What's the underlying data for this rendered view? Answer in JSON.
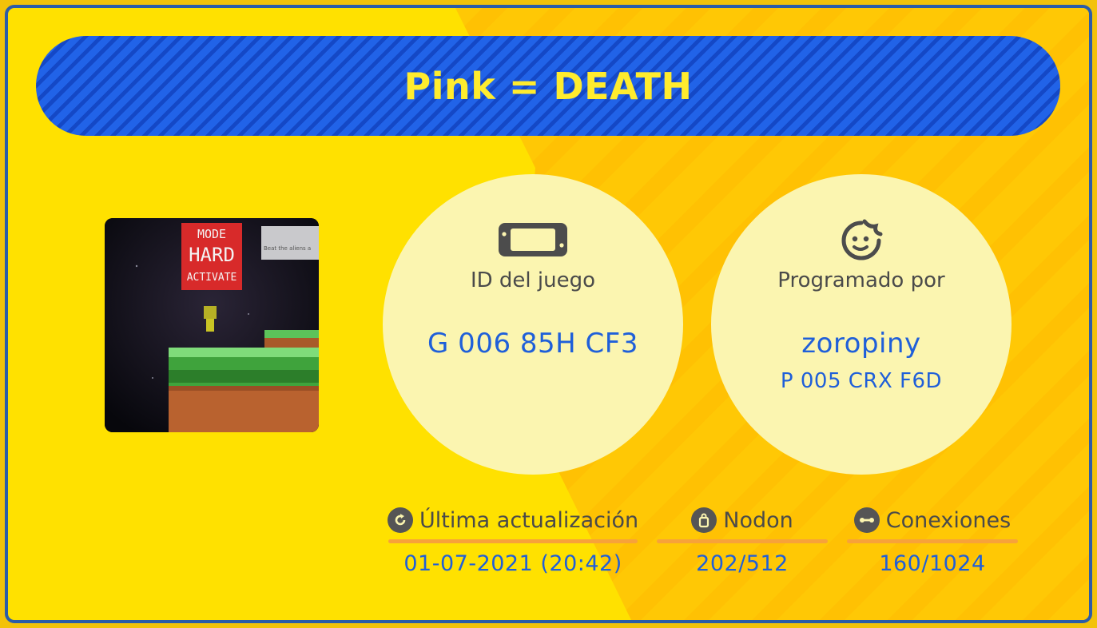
{
  "title": "Pink = DEATH",
  "thumbnail": {
    "sign_text": [
      "MODE",
      "HARD",
      "ACTIVATE"
    ],
    "note_text": "Beat the aliens a"
  },
  "game_id": {
    "label": "ID del juego",
    "value": "G 006 85H CF3",
    "icon": "switch-console-icon"
  },
  "author": {
    "label": "Programado por",
    "name": "zoropiny",
    "code": "P 005 CRX F6D",
    "icon": "smiley-face-icon"
  },
  "stats": {
    "updated": {
      "label": "Última actualización",
      "value": "01-07-2021 (20:42)",
      "icon": "refresh-icon"
    },
    "nodon": {
      "label": "Nodon",
      "value": "202/512",
      "icon": "bag-icon"
    },
    "connections": {
      "label": "Conexiones",
      "value": "160/1024",
      "icon": "connection-icon"
    }
  },
  "colors": {
    "background": "#ffe100",
    "border": "#2c5ca8",
    "title_bar": "#2163e8",
    "title_text": "#ffec2e",
    "circle": "#fbf5b0",
    "value_text": "#1f5fd9",
    "accent_bar": "#f7a23a"
  }
}
